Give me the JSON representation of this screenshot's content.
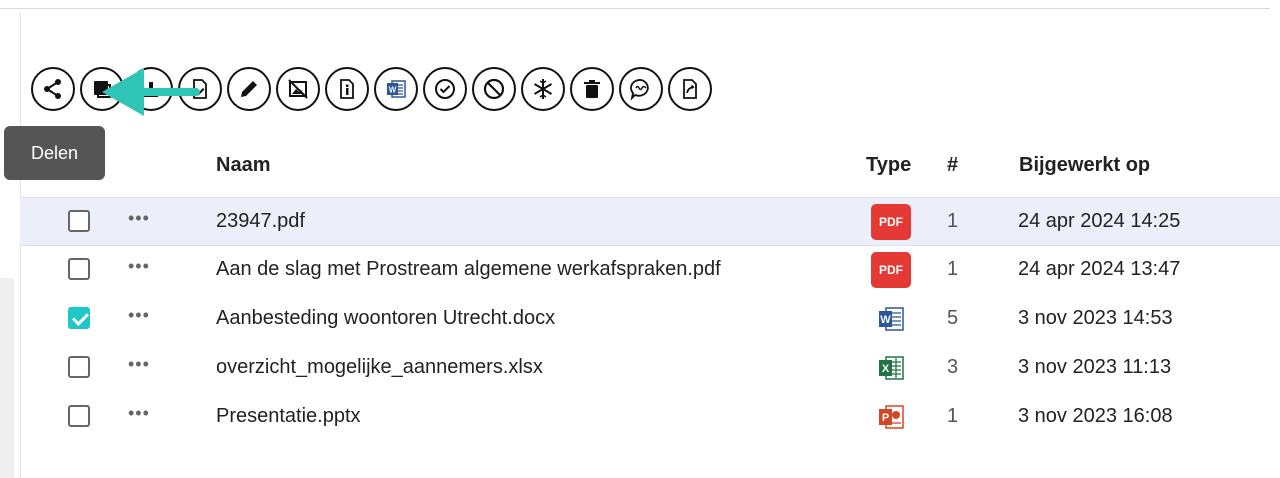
{
  "tooltip": {
    "text": "Delen"
  },
  "toolbar": {
    "buttons": [
      {
        "name": "share-button",
        "icon": "share-icon"
      },
      {
        "name": "copy-button",
        "icon": "copy-icon"
      },
      {
        "name": "upload-button",
        "icon": "upload-icon"
      },
      {
        "name": "edit-document-button",
        "icon": "document-edit-icon"
      },
      {
        "name": "edit-button",
        "icon": "pencil-icon"
      },
      {
        "name": "no-image-button",
        "icon": "image-off-icon"
      },
      {
        "name": "document-info-button",
        "icon": "document-info-icon"
      },
      {
        "name": "word-button",
        "icon": "word-icon"
      },
      {
        "name": "approve-button",
        "icon": "check-circle-icon"
      },
      {
        "name": "block-button",
        "icon": "block-icon"
      },
      {
        "name": "freeze-button",
        "icon": "snowflake-icon"
      },
      {
        "name": "delete-button",
        "icon": "trash-icon"
      },
      {
        "name": "comment-button",
        "icon": "chat-icon"
      },
      {
        "name": "export-button",
        "icon": "export-icon"
      }
    ]
  },
  "table": {
    "headers": {
      "name": "Naam",
      "type": "Type",
      "count": "#",
      "updated": "Bijgewerkt op"
    },
    "rows": [
      {
        "name": "23947.pdf",
        "type": "pdf",
        "type_label": "PDF",
        "count": "1",
        "updated": "24 apr 2024 14:25",
        "checked": false,
        "highlight": true
      },
      {
        "name": "Aan de slag met Prostream algemene werkafspraken.pdf",
        "type": "pdf",
        "type_label": "PDF",
        "count": "1",
        "updated": "24 apr 2024 13:47",
        "checked": false,
        "highlight": false
      },
      {
        "name": "Aanbesteding woontoren Utrecht.docx",
        "type": "docx",
        "count": "5",
        "updated": "3 nov 2023 14:53",
        "checked": true,
        "highlight": false
      },
      {
        "name": "overzicht_mogelijke_aannemers.xlsx",
        "type": "xlsx",
        "count": "3",
        "updated": "3 nov 2023 11:13",
        "checked": false,
        "highlight": false
      },
      {
        "name": "Presentatie.pptx",
        "type": "pptx",
        "count": "1",
        "updated": "3 nov 2023 16:08",
        "checked": false,
        "highlight": false
      }
    ],
    "row_menu_glyph": "•••"
  },
  "colors": {
    "accent": "#1fc7c9",
    "arrow": "#2ec4b6",
    "pdf": "#e53935",
    "word": "#2b579a",
    "excel": "#217346",
    "powerpoint": "#d24726",
    "highlight": "#eceef9"
  }
}
